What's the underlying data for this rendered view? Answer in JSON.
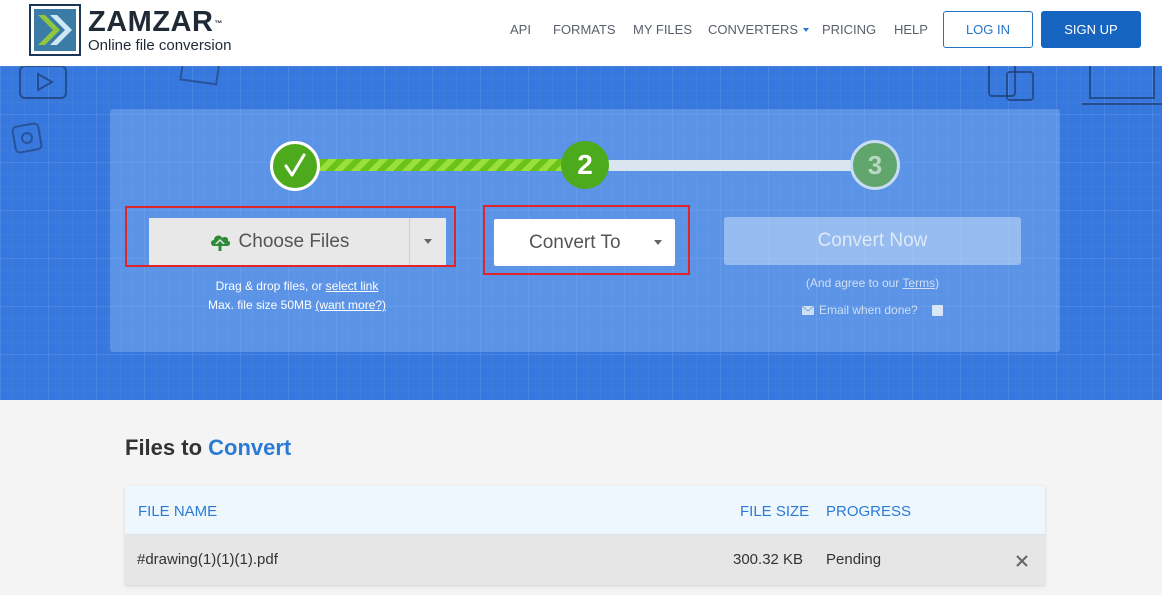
{
  "header": {
    "logo_name": "ZAMZAR",
    "logo_tm": "™",
    "logo_tagline": "Online file conversion",
    "nav": {
      "api": "API",
      "formats": "FORMATS",
      "my_files": "MY FILES",
      "converters": "CONVERTERS",
      "pricing": "PRICING",
      "help": "HELP"
    },
    "login": "LOG IN",
    "signup": "SIGN UP"
  },
  "steps": {
    "step1": "✓",
    "step2": "2",
    "step3": "3"
  },
  "uploader": {
    "choose_files": "Choose Files",
    "drop_text": "Drag & drop files, or ",
    "select_link": "select link",
    "max_size": "Max. file size 50MB ",
    "want_more": "(want more?)"
  },
  "converter": {
    "convert_to": "Convert To",
    "convert_now": "Convert Now",
    "agree_prefix": "(And agree to our ",
    "terms": "Terms",
    "agree_suffix": ")",
    "email_when_done": "Email when done?"
  },
  "files": {
    "title_prefix": "Files to ",
    "title_accent": "Convert",
    "columns": {
      "file_name": "FILE NAME",
      "file_size": "FILE SIZE",
      "progress": "PROGRESS"
    },
    "rows": [
      {
        "file_name": "#drawing(1)(1)(1).pdf",
        "file_size": "300.32 KB",
        "progress": "Pending"
      }
    ]
  },
  "colors": {
    "brand_blue": "#1565c0",
    "hero_blue": "#3778de",
    "step_green": "#4caa1c",
    "highlight_red": "#e0242a"
  }
}
